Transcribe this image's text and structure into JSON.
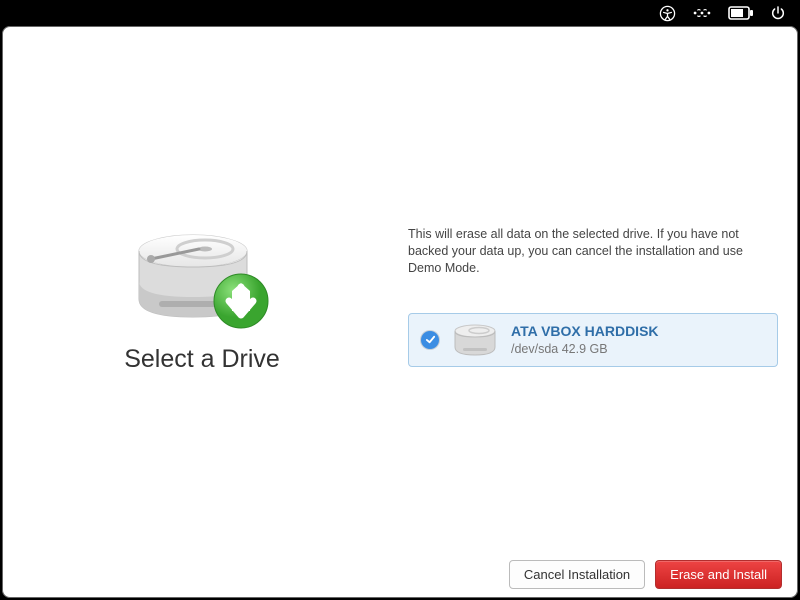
{
  "menubar": {
    "icons": [
      "accessibility",
      "network",
      "battery",
      "power"
    ]
  },
  "page": {
    "title": "Select a Drive",
    "warning": "This will erase all data on the selected drive. If you have not backed your data up, you can cancel the installation and use Demo Mode."
  },
  "drives": [
    {
      "name": "ATA VBOX HARDDISK",
      "sub": "/dev/sda 42.9 GB",
      "selected": true
    }
  ],
  "footer": {
    "cancel_label": "Cancel Installation",
    "install_label": "Erase and Install"
  }
}
